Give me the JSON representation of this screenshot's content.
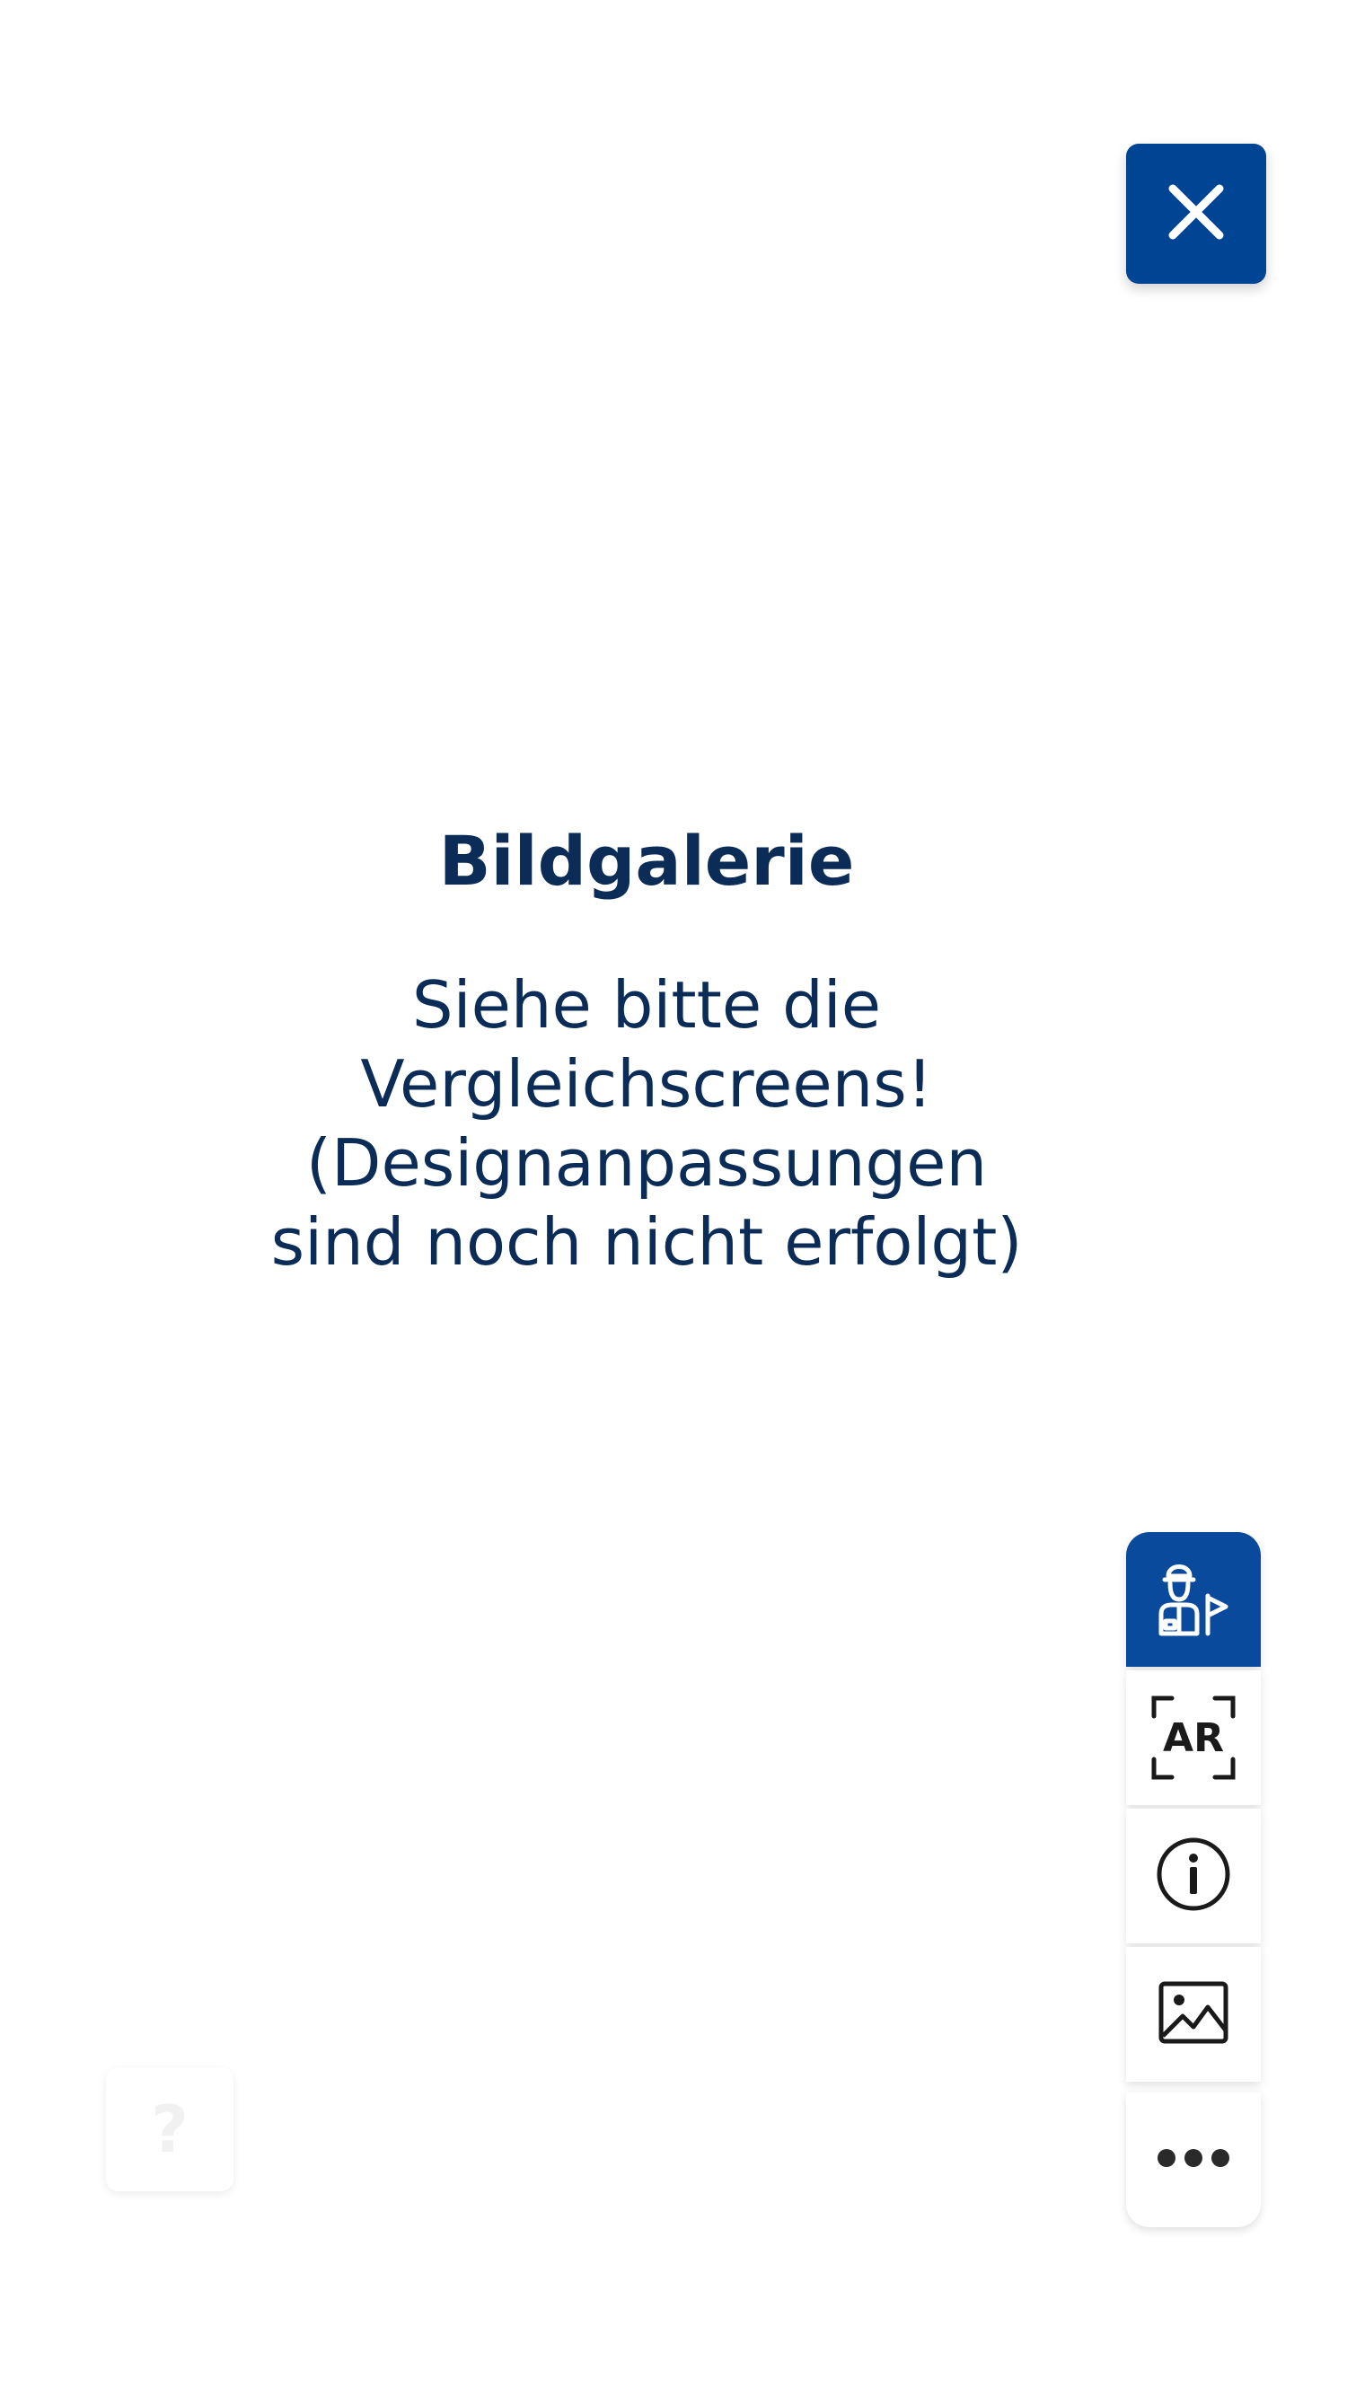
{
  "close_button": {
    "icon": "close-icon"
  },
  "gallery": {
    "title": "Bildgalerie",
    "message_lines": [
      "Siehe bitte die",
      "Vergleichscreens!",
      "(Designanpassungen",
      "sind noch nicht erfolgt)"
    ]
  },
  "toolbar": {
    "items": [
      {
        "name": "guide",
        "icon": "tour-guide-icon",
        "active": true
      },
      {
        "name": "ar",
        "icon": "ar-icon",
        "label": "AR"
      },
      {
        "name": "info",
        "icon": "info-icon"
      },
      {
        "name": "gallery",
        "icon": "image-icon"
      },
      {
        "name": "more",
        "icon": "more-icon"
      }
    ]
  },
  "help_button": {
    "label": "?"
  },
  "colors": {
    "primary_blue": "#004494",
    "text_navy": "#0b2c57",
    "background": "#ffffff"
  }
}
